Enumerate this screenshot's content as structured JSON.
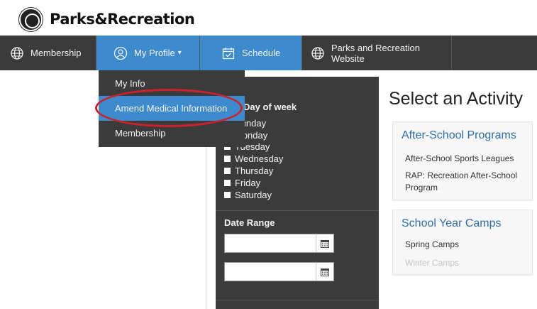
{
  "header": {
    "logo_text": "Parks&Recreation"
  },
  "nav": {
    "items": [
      {
        "label": "Membership",
        "icon": "globe-icon"
      },
      {
        "label": "My Profile",
        "caret": "▾",
        "icon": "user-icon"
      },
      {
        "label": "Schedule",
        "icon": "calendar-icon"
      },
      {
        "label": "Parks and Recreation Website",
        "icon": "globe-icon"
      }
    ]
  },
  "dropdown": {
    "items": [
      {
        "label": "My Info"
      },
      {
        "label": "Amend Medical Information",
        "highlighted": true
      },
      {
        "label": "Membership"
      }
    ]
  },
  "filter": {
    "day_title": "Day of week",
    "days": [
      "Sunday",
      "Monday",
      "Tuesday",
      "Wednesday",
      "Thursday",
      "Friday",
      "Saturday"
    ],
    "date_range_title": "Date Range",
    "date_from": "",
    "date_to": ""
  },
  "main": {
    "title": "Select an Activity",
    "cards": [
      {
        "title": "After-School Programs",
        "links": [
          "After-School Sports Leagues",
          "RAP: Recreation After-School Program"
        ]
      },
      {
        "title": "School Year Camps",
        "links": [
          "Spring Camps",
          "Winter Camps"
        ]
      }
    ]
  },
  "colors": {
    "nav_bg": "#3b3b3b",
    "accent": "#3d8bcc",
    "highlight_ring": "#c8232c",
    "card_title": "#2f6fa8"
  }
}
